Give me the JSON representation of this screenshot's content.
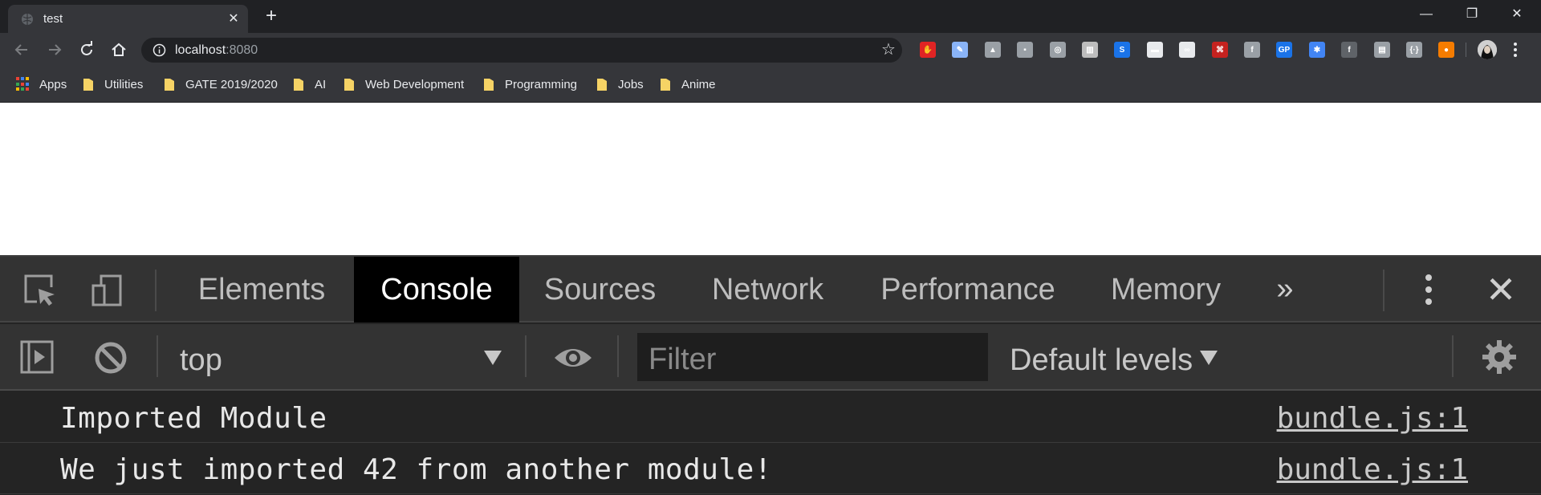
{
  "browser": {
    "tab": {
      "title": "test"
    },
    "window_controls": [
      "minimize",
      "restore",
      "close"
    ],
    "address": {
      "host": "localhost",
      "port": ":8080"
    },
    "extensions": [
      {
        "name": "adblock-icon",
        "color": "#e02424",
        "glyph": "✋"
      },
      {
        "name": "color-picker-icon",
        "color": "#8ab4f8",
        "glyph": "✎"
      },
      {
        "name": "drive-icon",
        "color": "#9aa0a6",
        "glyph": "▲"
      },
      {
        "name": "android-icon",
        "color": "#9aa0a6",
        "glyph": "▪"
      },
      {
        "name": "media-icon",
        "color": "#9aa0a6",
        "glyph": "◎"
      },
      {
        "name": "library-icon",
        "color": "#bdbdbd",
        "glyph": "▥"
      },
      {
        "name": "skype-icon",
        "color": "#1a73e8",
        "glyph": "S"
      },
      {
        "name": "ninja-icon",
        "color": "#e8eaed",
        "glyph": "▬"
      },
      {
        "name": "goggles-icon",
        "color": "#e8eaed",
        "glyph": "∞"
      },
      {
        "name": "pdf-icon",
        "color": "#c5221f",
        "glyph": "⌘"
      },
      {
        "name": "font-icon",
        "color": "#9aa0a6",
        "glyph": "f"
      },
      {
        "name": "gp-icon",
        "color": "#1a73e8",
        "glyph": "GP"
      },
      {
        "name": "gear-blue-icon",
        "color": "#4285f4",
        "glyph": "✱"
      },
      {
        "name": "facebook-icon",
        "color": "#5f6368",
        "glyph": "f"
      },
      {
        "name": "printer-icon",
        "color": "#9aa0a6",
        "glyph": "▤"
      },
      {
        "name": "devtools-ext-icon",
        "color": "#9aa0a6",
        "glyph": "{·}"
      },
      {
        "name": "fire-icon",
        "color": "#f57c00",
        "glyph": "●"
      }
    ],
    "bookmarks": [
      {
        "label": "Apps"
      },
      {
        "label": "Utilities"
      },
      {
        "label": "GATE 2019/2020"
      },
      {
        "label": "AI"
      },
      {
        "label": "Web Development"
      },
      {
        "label": "Programming"
      },
      {
        "label": "Jobs"
      },
      {
        "label": "Anime"
      }
    ]
  },
  "devtools": {
    "tabs": [
      {
        "label": "Elements",
        "active": false
      },
      {
        "label": "Console",
        "active": true
      },
      {
        "label": "Sources",
        "active": false
      },
      {
        "label": "Network",
        "active": false
      },
      {
        "label": "Performance",
        "active": false
      },
      {
        "label": "Memory",
        "active": false
      }
    ],
    "console_toolbar": {
      "context": "top",
      "filter_placeholder": "Filter",
      "levels": "Default levels"
    },
    "messages": [
      {
        "text": "Imported Module",
        "source": "bundle.js:1"
      },
      {
        "text": "We just imported 42 from another module!",
        "source": "bundle.js:1"
      }
    ]
  },
  "colors": {
    "titlebar": "#202124",
    "toolbar": "#35363a",
    "devtools_bg": "#242424",
    "active_tab": "#000000"
  }
}
